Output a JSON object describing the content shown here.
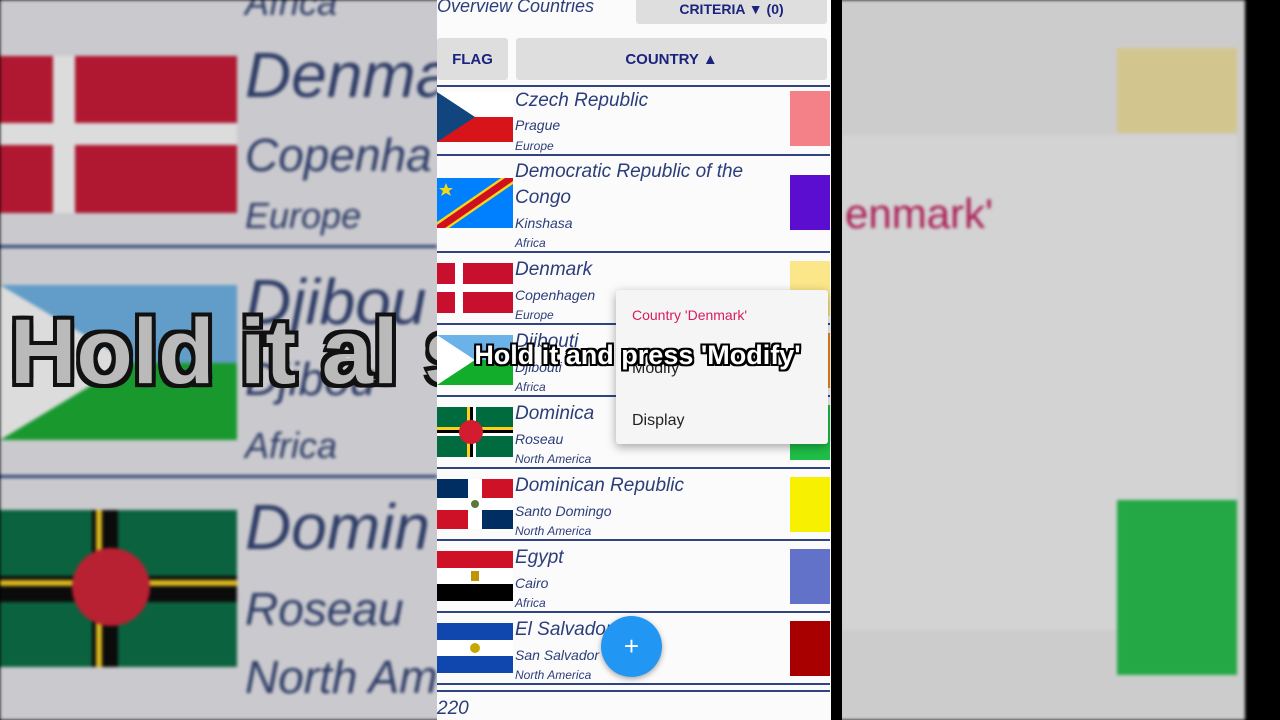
{
  "app": {
    "title": "Overview Countries",
    "criteria_label": "CRITERIA ▼ (0)",
    "flag_label": "FLAG",
    "country_label": "COUNTRY ▲",
    "count": "220",
    "fab_icon": "plus-icon",
    "fab_symbol": "+"
  },
  "countries": [
    {
      "name": "Czech Republic",
      "capital": "Prague",
      "continent": "Europe",
      "color": "#f48088"
    },
    {
      "name": "Democratic Republic of the Congo",
      "capital": "Kinshasa",
      "continent": "Africa",
      "color": "#5b0dd0"
    },
    {
      "name": "Denmark",
      "capital": "Copenhagen",
      "continent": "Europe",
      "color": "#fbe68a"
    },
    {
      "name": "Djibouti",
      "capital": "Djibouti",
      "continent": "Africa",
      "color": "#f08a1c"
    },
    {
      "name": "Dominica",
      "capital": "Roseau",
      "continent": "North America",
      "color": "#1fbf47"
    },
    {
      "name": "Dominican Republic",
      "capital": "Santo Domingo",
      "continent": "North America",
      "color": "#f7f000"
    },
    {
      "name": "Egypt",
      "capital": "Cairo",
      "continent": "Africa",
      "color": "#6272c8"
    },
    {
      "name": "El Salvador",
      "capital": "San Salvador",
      "continent": "North America",
      "color": "#a80000"
    }
  ],
  "context_menu": {
    "title": "Country 'Denmark'",
    "items": [
      "Modify",
      "Display"
    ]
  },
  "caption": "Hold it and press 'Modify'",
  "background": {
    "names": [
      "Denma",
      "Djibou",
      "Domin"
    ],
    "capitals": [
      "Copenha",
      "Djibou",
      "Roseau"
    ],
    "continents": [
      "Africa",
      "Europe",
      "Africa",
      "North Ame"
    ],
    "card_title": "enmark'",
    "caption": "Hold it al          s 'Modify'"
  },
  "colors": {
    "accent_blue": "#2196f3",
    "text_navy": "#2c3e7a",
    "menu_title_pink": "#d81b60"
  }
}
